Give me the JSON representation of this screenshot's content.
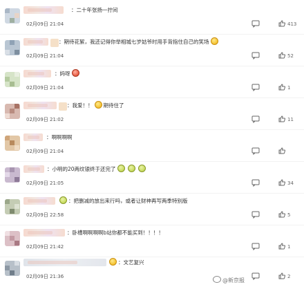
{
  "comments": [
    {
      "text": "：二十年张扬一拧间",
      "time": "02月09日 21:04",
      "likes": "413",
      "emojis": []
    },
    {
      "text": "：期待花絮，我还记得你举相城七岁姑爷时用手背指住自己的笑场",
      "time": "02月09日 21:04",
      "likes": "52",
      "emojis": [
        "yellow"
      ]
    },
    {
      "text": "：妈呀",
      "time": "02月09日 21:04",
      "likes": "1",
      "emojis": [
        "red"
      ]
    },
    {
      "text": "：我爱！！",
      "text2": "期待住了",
      "time": "02月09日 21:02",
      "likes": "11",
      "emojis": [
        "yellow"
      ]
    },
    {
      "text": "：啊啊啊啊",
      "time": "02月09日 21:04",
      "likes": "",
      "emojis": []
    },
    {
      "text": "：小明的20两纹银终于还完了",
      "time": "02月09日 21:05",
      "likes": "34",
      "emojis": [
        "green",
        "green",
        "green"
      ]
    },
    {
      "text": "：把删减的放出来行吗，或者让财神再写两季特别版",
      "time": "02月09日 22:58",
      "likes": "5",
      "emojis": [
        "green"
      ]
    },
    {
      "text": "：卧槽啊啊啊啊b站你都不能买到！！！！",
      "time": "02月09日 21:42",
      "likes": "1",
      "emojis": []
    },
    {
      "text": "：文艺复兴",
      "time": "02月09日 21:36",
      "likes": "2",
      "emojis": [
        "yellow"
      ]
    }
  ],
  "watermark": "@新京报",
  "colors": {
    "text": "#333333",
    "meta": "#555555",
    "divider": "#f2f2f2"
  },
  "icons": {
    "comment": "comment-icon",
    "like": "thumbs-up-icon"
  }
}
